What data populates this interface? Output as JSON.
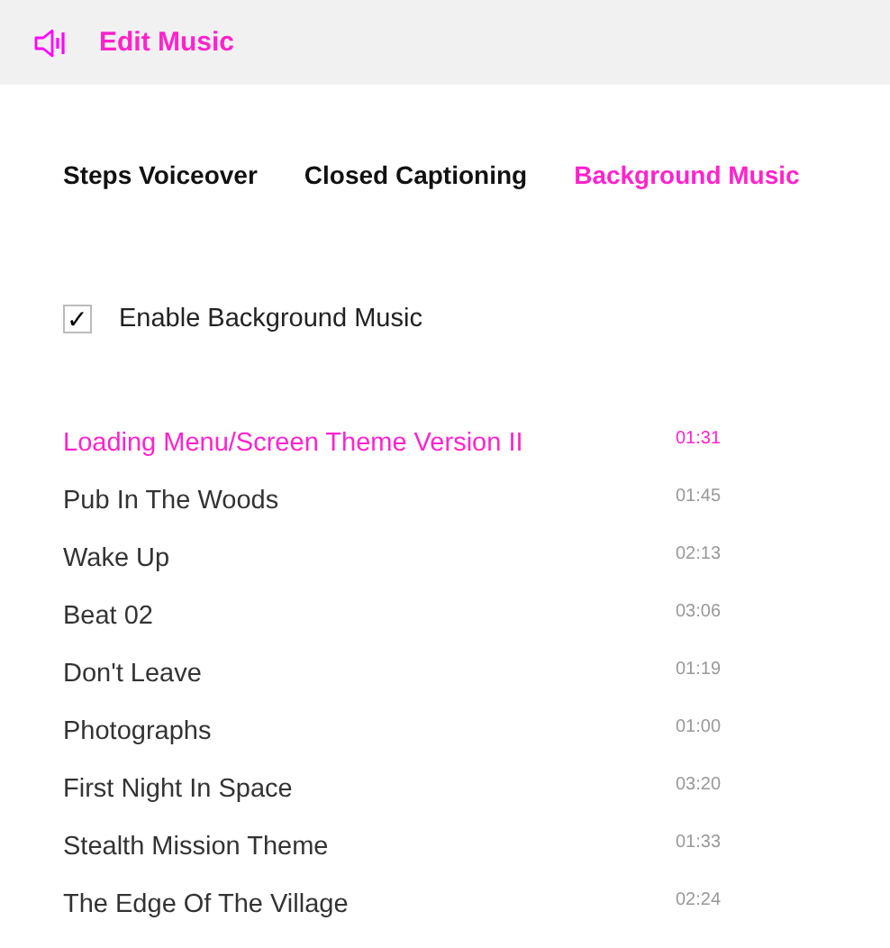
{
  "header": {
    "title": "Edit Music"
  },
  "tabs": [
    {
      "label": "Steps Voiceover",
      "selected": false
    },
    {
      "label": "Closed Captioning",
      "selected": false
    },
    {
      "label": "Background Music",
      "selected": true
    }
  ],
  "enable": {
    "label": "Enable Background Music",
    "checked": true,
    "mark": "✓"
  },
  "tracks": [
    {
      "name": "Loading Menu/Screen Theme Version II",
      "duration": "01:31",
      "selected": true
    },
    {
      "name": "Pub In The Woods",
      "duration": "01:45",
      "selected": false
    },
    {
      "name": "Wake Up",
      "duration": "02:13",
      "selected": false
    },
    {
      "name": "Beat 02",
      "duration": "03:06",
      "selected": false
    },
    {
      "name": "Don't Leave",
      "duration": "01:19",
      "selected": false
    },
    {
      "name": "Photographs",
      "duration": "01:00",
      "selected": false
    },
    {
      "name": "First Night In Space",
      "duration": "03:20",
      "selected": false
    },
    {
      "name": "Stealth Mission Theme",
      "duration": "01:33",
      "selected": false
    },
    {
      "name": "The Edge Of The Village",
      "duration": "02:24",
      "selected": false
    }
  ]
}
